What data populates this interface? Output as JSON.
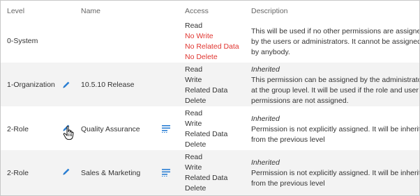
{
  "headers": {
    "level": "Level",
    "name": "Name",
    "access": "Access",
    "description": "Description"
  },
  "rows": [
    {
      "level": "0-System",
      "name": "",
      "access": [
        {
          "label": "Read",
          "color": "#333333"
        },
        {
          "label": "No Write",
          "color": "#e0342f"
        },
        {
          "label": "No Related Data",
          "color": "#e0342f"
        },
        {
          "label": "No Delete",
          "color": "#e0342f"
        }
      ],
      "desc_title": "",
      "desc": [
        "This will be used if no other permissions are assigned",
        "by the users or administrators. It cannot be assigned",
        "by anybody."
      ]
    },
    {
      "level": "1-Organization",
      "name": "10.5.10 Release",
      "access": [
        {
          "label": "Read"
        },
        {
          "label": "Write"
        },
        {
          "label": "Related Data"
        },
        {
          "label": "Delete"
        }
      ],
      "desc_title": "Inherited",
      "desc": [
        "This permission can be assigned by the administrator",
        "at the group level. It will be used if the role and user",
        "permissions are not assigned."
      ]
    },
    {
      "level": "2-Role",
      "name": "Quality Assurance",
      "access": [
        {
          "label": "Read"
        },
        {
          "label": "Write"
        },
        {
          "label": "Related Data"
        },
        {
          "label": "Delete"
        }
      ],
      "desc_title": "Inherited",
      "desc": [
        "Permission is not explicitly assigned. It will be inherite",
        "from the previous level"
      ]
    },
    {
      "level": "2-Role",
      "name": "Sales & Marketing",
      "access": [
        {
          "label": "Read"
        },
        {
          "label": "Write"
        },
        {
          "label": "Related Data"
        },
        {
          "label": "Delete"
        }
      ],
      "desc_title": "Inherited",
      "desc": [
        "Permission is not explicitly assigned. It will be inherite",
        "from the previous level"
      ]
    }
  ],
  "icons": {
    "edit": "pencil-icon",
    "details": "list-details-icon",
    "cursor": "hand-pointer-cursor-icon"
  },
  "colors": {
    "accent": "#2a7fd4",
    "denied": "#e0342f",
    "row_shade": "#f3f3f3",
    "header_text": "#666666"
  }
}
